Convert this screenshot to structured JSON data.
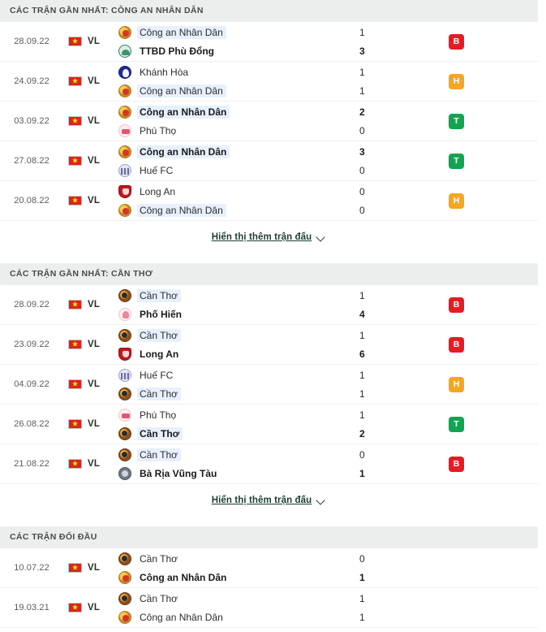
{
  "sections": [
    {
      "id": "form-cand",
      "title": "CÁC TRẬN GẦN NHẤT: CÔNG AN NHÂN DÂN",
      "show_more_label": "Hiển thị thêm trận đấu",
      "has_show_more": true,
      "matches": [
        {
          "date": "28.09.22",
          "competition": "VL",
          "country_flag": "vietnam-flag",
          "home": {
            "name": "Công an Nhân Dân",
            "logo": "cand-crest",
            "bold": false,
            "highlight": true,
            "score": "1"
          },
          "away": {
            "name": "TTBD Phù Đổng",
            "logo": "ttbd-phu-dong-crest",
            "bold": true,
            "highlight": false,
            "score": "3"
          },
          "result": {
            "label": "B",
            "type": "loss",
            "color": "#e51c23"
          }
        },
        {
          "date": "24.09.22",
          "competition": "VL",
          "country_flag": "vietnam-flag",
          "home": {
            "name": "Khánh Hòa",
            "logo": "khanh-hoa-crest",
            "bold": false,
            "highlight": false,
            "score": "1"
          },
          "away": {
            "name": "Công an Nhân Dân",
            "logo": "cand-crest",
            "bold": false,
            "highlight": true,
            "score": "1"
          },
          "result": {
            "label": "H",
            "type": "draw",
            "color": "#f5a623"
          }
        },
        {
          "date": "03.09.22",
          "competition": "VL",
          "country_flag": "vietnam-flag",
          "home": {
            "name": "Công an Nhân Dân",
            "logo": "cand-crest",
            "bold": true,
            "highlight": true,
            "score": "2"
          },
          "away": {
            "name": "Phú Thọ",
            "logo": "phu-tho-crest",
            "bold": false,
            "highlight": false,
            "score": "0"
          },
          "result": {
            "label": "T",
            "type": "win",
            "color": "#10a551"
          }
        },
        {
          "date": "27.08.22",
          "competition": "VL",
          "country_flag": "vietnam-flag",
          "home": {
            "name": "Công an Nhân Dân",
            "logo": "cand-crest",
            "bold": true,
            "highlight": true,
            "score": "3"
          },
          "away": {
            "name": "Huế FC",
            "logo": "hue-fc-crest",
            "bold": false,
            "highlight": false,
            "score": "0"
          },
          "result": {
            "label": "T",
            "type": "win",
            "color": "#10a551"
          }
        },
        {
          "date": "20.08.22",
          "competition": "VL",
          "country_flag": "vietnam-flag",
          "home": {
            "name": "Long An",
            "logo": "long-an-crest",
            "bold": false,
            "highlight": false,
            "score": "0"
          },
          "away": {
            "name": "Công an Nhân Dân",
            "logo": "cand-crest",
            "bold": false,
            "highlight": true,
            "score": "0"
          },
          "result": {
            "label": "H",
            "type": "draw",
            "color": "#f5a623"
          }
        }
      ]
    },
    {
      "id": "form-cantho",
      "title": "CÁC TRẬN GẦN NHẤT: CẦN THƠ",
      "show_more_label": "Hiển thị thêm trận đấu",
      "has_show_more": true,
      "matches": [
        {
          "date": "28.09.22",
          "competition": "VL",
          "country_flag": "vietnam-flag",
          "home": {
            "name": "Cần Thơ",
            "logo": "can-tho-crest",
            "bold": false,
            "highlight": true,
            "score": "1"
          },
          "away": {
            "name": "Phố Hiến",
            "logo": "pho-hien-crest",
            "bold": true,
            "highlight": false,
            "score": "4"
          },
          "result": {
            "label": "B",
            "type": "loss",
            "color": "#e51c23"
          }
        },
        {
          "date": "23.09.22",
          "competition": "VL",
          "country_flag": "vietnam-flag",
          "home": {
            "name": "Cần Thơ",
            "logo": "can-tho-crest",
            "bold": false,
            "highlight": true,
            "score": "1"
          },
          "away": {
            "name": "Long An",
            "logo": "long-an-crest",
            "bold": true,
            "highlight": false,
            "score": "6"
          },
          "result": {
            "label": "B",
            "type": "loss",
            "color": "#e51c23"
          }
        },
        {
          "date": "04.09.22",
          "competition": "VL",
          "country_flag": "vietnam-flag",
          "home": {
            "name": "Huế FC",
            "logo": "hue-fc-crest",
            "bold": false,
            "highlight": false,
            "score": "1"
          },
          "away": {
            "name": "Cần Thơ",
            "logo": "can-tho-crest",
            "bold": false,
            "highlight": true,
            "score": "1"
          },
          "result": {
            "label": "H",
            "type": "draw",
            "color": "#f5a623"
          }
        },
        {
          "date": "26.08.22",
          "competition": "VL",
          "country_flag": "vietnam-flag",
          "home": {
            "name": "Phú Thọ",
            "logo": "phu-tho-crest",
            "bold": false,
            "highlight": false,
            "score": "1"
          },
          "away": {
            "name": "Cần Thơ",
            "logo": "can-tho-crest",
            "bold": true,
            "highlight": true,
            "score": "2"
          },
          "result": {
            "label": "T",
            "type": "win",
            "color": "#10a551"
          }
        },
        {
          "date": "21.08.22",
          "competition": "VL",
          "country_flag": "vietnam-flag",
          "home": {
            "name": "Cần Thơ",
            "logo": "can-tho-crest",
            "bold": false,
            "highlight": true,
            "score": "0"
          },
          "away": {
            "name": "Bà Rịa Vũng Tàu",
            "logo": "ba-ria-vung-tau-crest",
            "bold": true,
            "highlight": false,
            "score": "1"
          },
          "result": {
            "label": "B",
            "type": "loss",
            "color": "#e51c23"
          }
        }
      ]
    },
    {
      "id": "head-to-head",
      "title": "CÁC TRẬN ĐỐI ĐẦU",
      "show_more_label": "",
      "has_show_more": false,
      "matches": [
        {
          "date": "10.07.22",
          "competition": "VL",
          "country_flag": "vietnam-flag",
          "home": {
            "name": "Cần Thơ",
            "logo": "can-tho-crest",
            "bold": false,
            "highlight": false,
            "score": "0"
          },
          "away": {
            "name": "Công an Nhân Dân",
            "logo": "cand-crest",
            "bold": true,
            "highlight": false,
            "score": "1"
          },
          "result": {
            "label": "",
            "type": "none",
            "color": ""
          }
        },
        {
          "date": "19.03.21",
          "competition": "VL",
          "country_flag": "vietnam-flag",
          "home": {
            "name": "Cần Thơ",
            "logo": "can-tho-crest",
            "bold": false,
            "highlight": false,
            "score": "1"
          },
          "away": {
            "name": "Công an Nhân Dân",
            "logo": "cand-crest",
            "bold": false,
            "highlight": false,
            "score": "1"
          },
          "result": {
            "label": "",
            "type": "none",
            "color": ""
          }
        }
      ]
    }
  ],
  "icons": {
    "chevron_down": "chevron-down-icon",
    "star": "★"
  }
}
